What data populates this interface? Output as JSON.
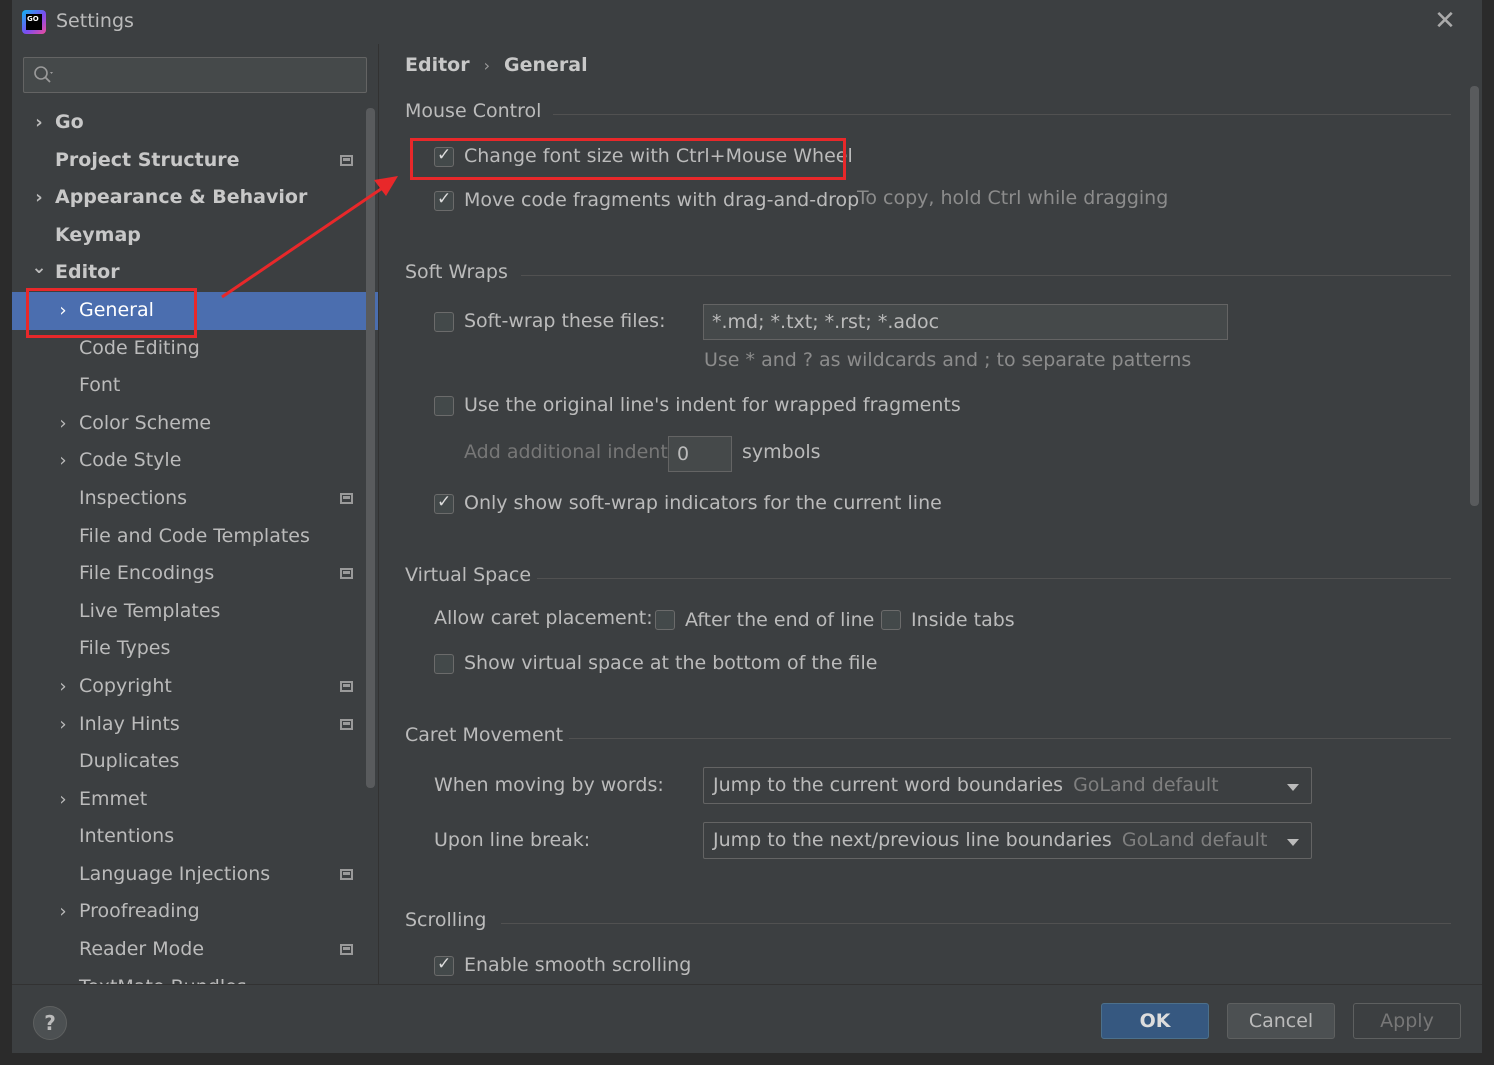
{
  "window": {
    "title": "Settings",
    "close_icon": "✕"
  },
  "search": {
    "placeholder": ""
  },
  "sidebar": {
    "items": [
      {
        "label": "Go",
        "level": 0,
        "bold": true,
        "chevron": "right",
        "icon": false
      },
      {
        "label": "Project Structure",
        "level": 0,
        "bold": true,
        "chevron": "none",
        "icon": true
      },
      {
        "label": "Appearance & Behavior",
        "level": 0,
        "bold": true,
        "chevron": "right",
        "icon": false
      },
      {
        "label": "Keymap",
        "level": 0,
        "bold": true,
        "chevron": "none",
        "icon": false
      },
      {
        "label": "Editor",
        "level": 0,
        "bold": true,
        "chevron": "down",
        "icon": false
      },
      {
        "label": "General",
        "level": 1,
        "bold": false,
        "chevron": "right",
        "icon": false,
        "selected": true
      },
      {
        "label": "Code Editing",
        "level": 1,
        "bold": false,
        "chevron": "none",
        "icon": false
      },
      {
        "label": "Font",
        "level": 1,
        "bold": false,
        "chevron": "none",
        "icon": false
      },
      {
        "label": "Color Scheme",
        "level": 1,
        "bold": false,
        "chevron": "right",
        "icon": false
      },
      {
        "label": "Code Style",
        "level": 1,
        "bold": false,
        "chevron": "right",
        "icon": false
      },
      {
        "label": "Inspections",
        "level": 1,
        "bold": false,
        "chevron": "none",
        "icon": true
      },
      {
        "label": "File and Code Templates",
        "level": 1,
        "bold": false,
        "chevron": "none",
        "icon": false
      },
      {
        "label": "File Encodings",
        "level": 1,
        "bold": false,
        "chevron": "none",
        "icon": true
      },
      {
        "label": "Live Templates",
        "level": 1,
        "bold": false,
        "chevron": "none",
        "icon": false
      },
      {
        "label": "File Types",
        "level": 1,
        "bold": false,
        "chevron": "none",
        "icon": false
      },
      {
        "label": "Copyright",
        "level": 1,
        "bold": false,
        "chevron": "right",
        "icon": true
      },
      {
        "label": "Inlay Hints",
        "level": 1,
        "bold": false,
        "chevron": "right",
        "icon": true
      },
      {
        "label": "Duplicates",
        "level": 1,
        "bold": false,
        "chevron": "none",
        "icon": false
      },
      {
        "label": "Emmet",
        "level": 1,
        "bold": false,
        "chevron": "right",
        "icon": false
      },
      {
        "label": "Intentions",
        "level": 1,
        "bold": false,
        "chevron": "none",
        "icon": false
      },
      {
        "label": "Language Injections",
        "level": 1,
        "bold": false,
        "chevron": "none",
        "icon": true
      },
      {
        "label": "Proofreading",
        "level": 1,
        "bold": false,
        "chevron": "right",
        "icon": false
      },
      {
        "label": "Reader Mode",
        "level": 1,
        "bold": false,
        "chevron": "none",
        "icon": true
      },
      {
        "label": "TextMate Bundles",
        "level": 1,
        "bold": false,
        "chevron": "none",
        "icon": false
      }
    ]
  },
  "breadcrumb": {
    "parent": "Editor",
    "separator": "›",
    "current": "General"
  },
  "sections": {
    "mouse_control": {
      "title": "Mouse Control",
      "change_font_size": {
        "label": "Change font size with Ctrl+Mouse Wheel",
        "checked": true
      },
      "move_fragments": {
        "label": "Move code fragments with drag-and-drop",
        "checked": true,
        "hint": "To copy, hold Ctrl while dragging"
      }
    },
    "soft_wraps": {
      "title": "Soft Wraps",
      "soft_wrap_files": {
        "label": "Soft-wrap these files:",
        "checked": false,
        "value": "*.md; *.txt; *.rst; *.adoc"
      },
      "wildcards_hint": "Use * and ? as wildcards and ; to separate patterns",
      "original_indent": {
        "label": "Use the original line's indent for wrapped fragments",
        "checked": false
      },
      "additional_indent": {
        "label": "Add additional indent:",
        "value": "0",
        "unit": "symbols"
      },
      "only_current_line": {
        "label": "Only show soft-wrap indicators for the current line",
        "checked": true
      }
    },
    "virtual_space": {
      "title": "Virtual Space",
      "allow_caret_label": "Allow caret placement:",
      "after_end_of_line": {
        "label": "After the end of line",
        "checked": false
      },
      "inside_tabs": {
        "label": "Inside tabs",
        "checked": false
      },
      "show_virtual_space": {
        "label": "Show virtual space at the bottom of the file",
        "checked": false
      }
    },
    "caret_movement": {
      "title": "Caret Movement",
      "moving_by_words": {
        "label": "When moving by words:",
        "value": "Jump to the current word boundaries",
        "default_hint": "GoLand default"
      },
      "upon_line_break": {
        "label": "Upon line break:",
        "value": "Jump to the next/previous line boundaries",
        "default_hint": "GoLand default"
      }
    },
    "scrolling": {
      "title": "Scrolling",
      "smooth_scrolling": {
        "label": "Enable smooth scrolling",
        "checked": true
      }
    }
  },
  "buttons": {
    "help": "?",
    "ok": "OK",
    "cancel": "Cancel",
    "apply": "Apply"
  },
  "colors": {
    "background": "#3c3f41",
    "selection": "#4b6eaf",
    "ok_button": "#365880",
    "annotation": "#e8282a"
  }
}
